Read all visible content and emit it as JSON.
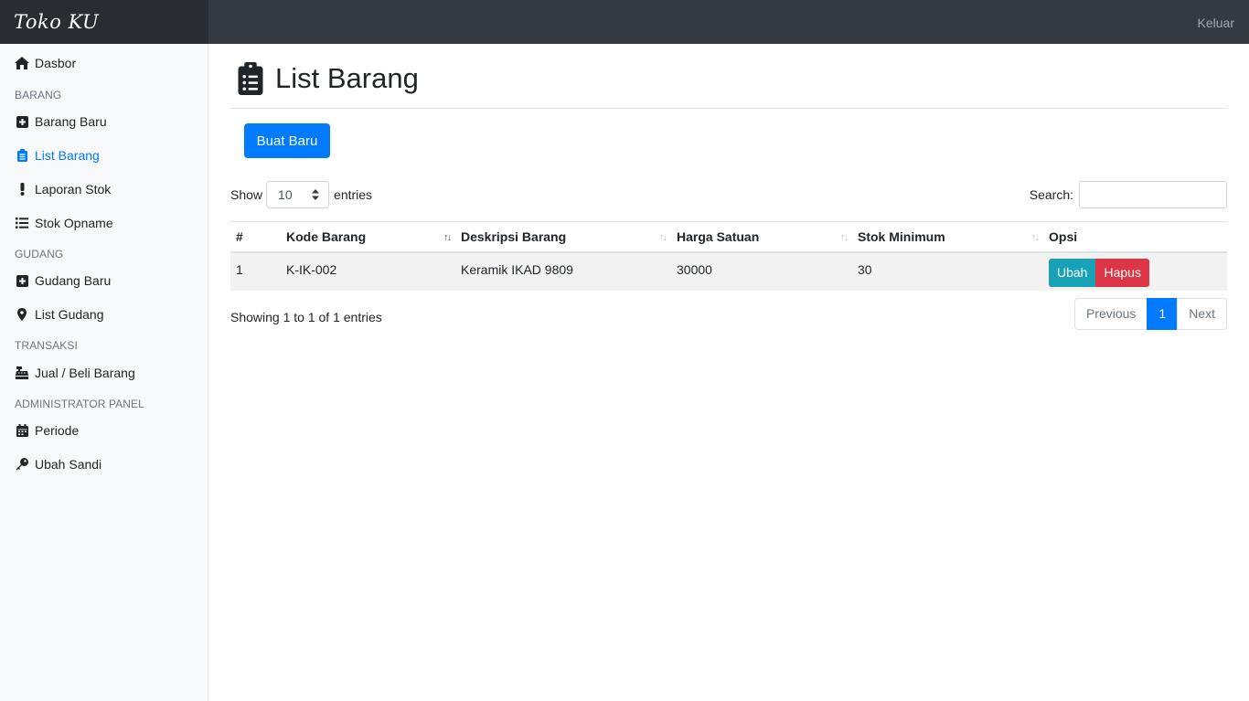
{
  "brand": "Toko KU",
  "header": {
    "logout_label": "Keluar"
  },
  "sidebar": {
    "dashboard": "Dasbor",
    "sections": {
      "barang": "BARANG",
      "gudang": "GUDANG",
      "transaksi": "TRANSAKSI",
      "admin": "ADMINISTRATOR PANEL"
    },
    "items": {
      "barang_baru": "Barang Baru",
      "list_barang": "List Barang",
      "laporan_stok": "Laporan Stok",
      "stok_opname": "Stok Opname",
      "gudang_baru": "Gudang Baru",
      "list_gudang": "List Gudang",
      "jual_beli": "Jual / Beli Barang",
      "periode": "Periode",
      "ubah_sandi": "Ubah Sandi"
    }
  },
  "main": {
    "title": "List Barang",
    "new_button": "Buat Baru",
    "length": {
      "prefix": "Show",
      "value": "10",
      "suffix": "entries"
    },
    "search_label": "Search:",
    "search_value": "",
    "columns": [
      "#",
      "Kode Barang",
      "Deskripsi Barang",
      "Harga Satuan",
      "Stok Minimum",
      "Opsi"
    ],
    "rows": [
      {
        "no": "1",
        "kode": "K-IK-002",
        "deskripsi": "Keramik IKAD 9809",
        "harga": "30000",
        "stok_min": "30",
        "edit": "Ubah",
        "delete": "Hapus"
      }
    ],
    "info": "Showing 1 to 1 of 1 entries",
    "pagination": {
      "previous": "Previous",
      "current": "1",
      "next": "Next"
    }
  },
  "colors": {
    "primary": "#007bff",
    "info": "#17a2b8",
    "danger": "#dc3545",
    "navbar": "#343a40"
  }
}
